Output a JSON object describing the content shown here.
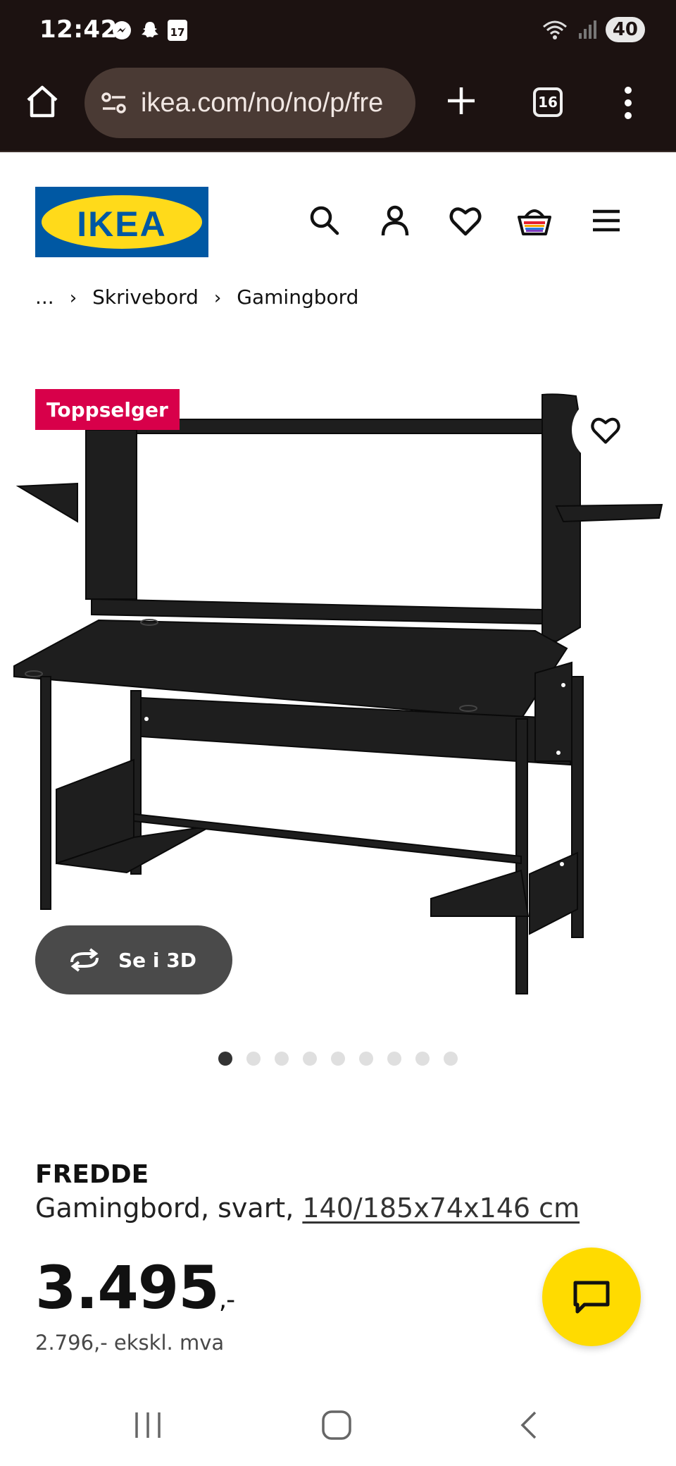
{
  "status_bar": {
    "time": "12:42",
    "notification_icons": [
      "messenger-icon",
      "snapchat-icon",
      "calendar-icon"
    ],
    "calendar_day": "17",
    "wifi_label": "5",
    "battery": "40"
  },
  "browser": {
    "url": "ikea.com/no/no/p/fre",
    "tab_count": "16"
  },
  "site": {
    "logo_text": "IKEA",
    "header_icons": [
      "search-icon",
      "account-icon",
      "heart-icon",
      "basket-icon",
      "menu-icon"
    ]
  },
  "breadcrumb": {
    "ellipsis": "...",
    "items": [
      "Skrivebord",
      "Gamingbord"
    ]
  },
  "product": {
    "badge": "Toppselger",
    "view_3d_label": "Se i 3D",
    "image_count": 9,
    "active_image": 1,
    "brand": "FREDDE",
    "description": "Gamingbord, svart, ",
    "dimensions": "140/185x74x146 cm",
    "price": "3.495",
    "price_suffix": ",-",
    "price_ex_vat": "2.796,- ekskl. mva"
  },
  "colors": {
    "browser_bg": "#1c1211",
    "ikea_blue": "#0058a3",
    "ikea_yellow": "#ffda1a",
    "badge_red": "#d8004a",
    "chat_yellow": "#ffdb00"
  }
}
